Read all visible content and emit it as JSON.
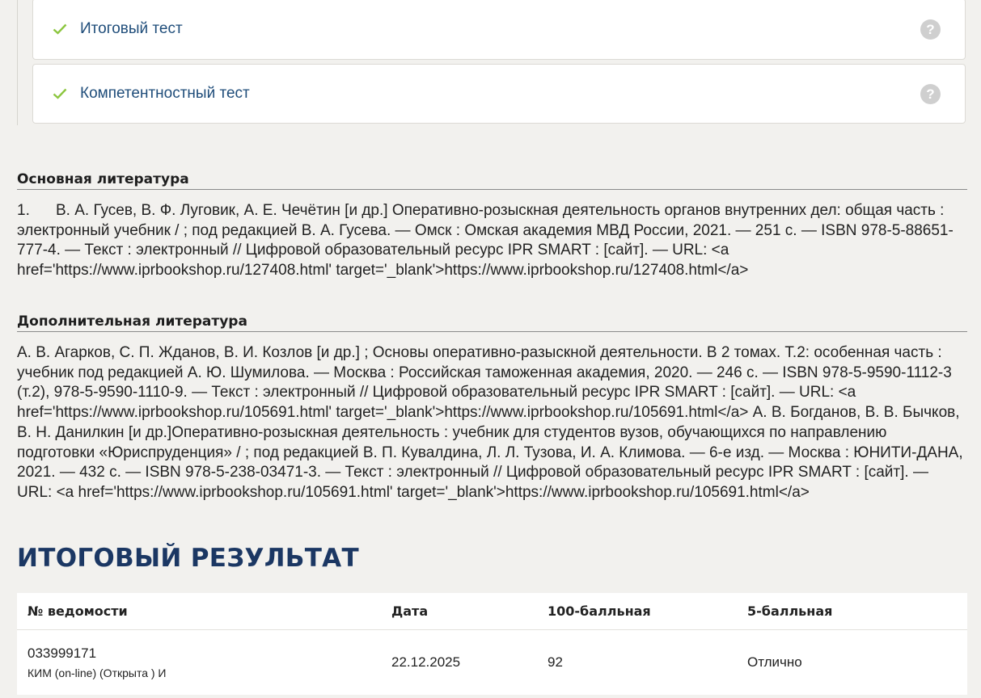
{
  "tests": [
    {
      "label": "Итоговый тест",
      "help": "?"
    },
    {
      "label": "Компетентностный тест",
      "help": "?"
    }
  ],
  "main_literature": {
    "title": "Основная литература",
    "number": "1.",
    "text": "В. А. Гусев, В. Ф. Луговик, А. Е. Чечётин [и др.] Оперативно-розыскная деятельность органов внутренних дел: общая часть : электронный учебник / ; под редакцией В. А. Гусева. — Омск : Омская академия МВД России, 2021. — 251 с. — ISBN 978-5-88651-777-4. — Текст : электронный // Цифровой образовательный ресурс IPR SMART : [сайт]. — URL: <a href='https://www.iprbookshop.ru/127408.html' target='_blank'>https://www.iprbookshop.ru/127408.html</a>"
  },
  "additional_literature": {
    "title": "Дополнительная литература",
    "text": "А. В. Агарков, С. П. Жданов, В. И. Козлов [и др.] ; Основы оперативно-разыскной деятельности. В 2 томах. Т.2: особенная часть : учебник под редакцией А. Ю. Шумилова. — Москва : Российская таможенная академия, 2020. — 246 с. — ISBN 978-5-9590-1112-3 (т.2), 978-5-9590-1110-9. — Текст : электронный // Цифровой образовательный ресурс IPR SMART : [сайт]. — URL: <a href='https://www.iprbookshop.ru/105691.html' target='_blank'>https://www.iprbookshop.ru/105691.html</a> А. В. Богданов, В. В. Бычков, В. Н. Данилкин [и др.]Оперативно-розыскная деятельность : учебник для студентов вузов, обучающихся по направлению подготовки «Юриспруденция» / ; под редакцией В. П. Кувалдина, Л. Л. Тузова, И. А. Климова. — 6-е изд. — Москва : ЮНИТИ-ДАНА, 2021. — 432 с. — ISBN 978-5-238-03471-3. — Текст : электронный // Цифровой образовательный ресурс IPR SMART : [сайт]. — URL: <a href='https://www.iprbookshop.ru/105691.html' target='_blank'>https://www.iprbookshop.ru/105691.html</a>"
  },
  "result": {
    "title": "ИТОГОВЫЙ РЕЗУЛЬТАТ",
    "headers": [
      "№ ведомости",
      "Дата",
      "100-балльная",
      "5-балльная"
    ],
    "row": {
      "number": "033999171",
      "type": "КИМ (on-line) (Открыта ) И",
      "date": "22.12.2025",
      "score100": "92",
      "score5": "Отлично"
    }
  },
  "colors": {
    "check": "#8cc63f",
    "link": "#1f4d7a",
    "heading": "#1b3763",
    "help_icon": "#cfcfcf"
  },
  "icons": {
    "check": "check-icon",
    "help": "help-icon"
  }
}
